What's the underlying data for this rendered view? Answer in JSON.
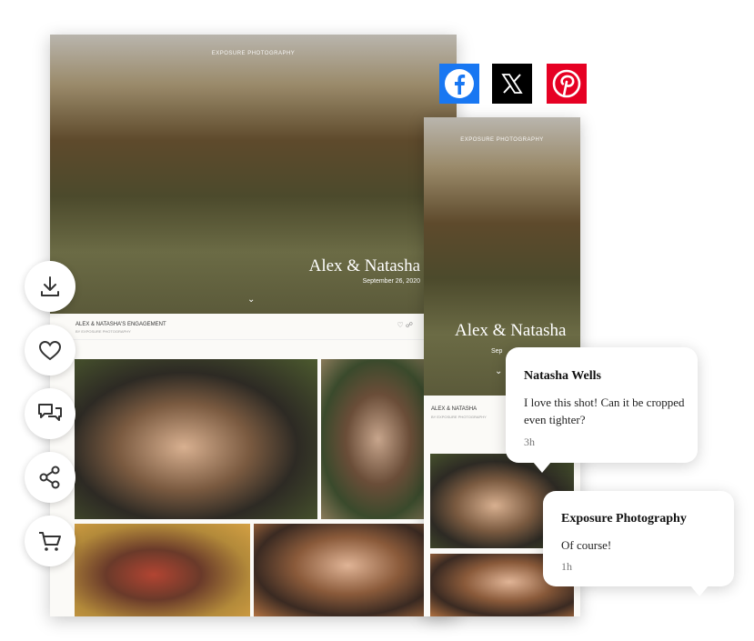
{
  "brand": "EXPOSURE PHOTOGRAPHY",
  "hero": {
    "title": "Alex & Natasha",
    "date": "September 26, 2020"
  },
  "gallery": {
    "title": "ALEX & NATASHA'S ENGAGEMENT",
    "byline": "BY EXPOSURE PHOTOGRAPHY"
  },
  "mobile": {
    "title": "Alex & Natasha",
    "date_partial": "Sep",
    "gallery_title": "ALEX & NATASHA",
    "byline": "BY EXPOSURE PHOTOGRAPHY"
  },
  "social": [
    {
      "name": "facebook",
      "icon": "facebook-icon",
      "color": "#1877f2"
    },
    {
      "name": "x",
      "icon": "x-icon",
      "color": "#000000"
    },
    {
      "name": "pinterest",
      "icon": "pinterest-icon",
      "color": "#e60023"
    }
  ],
  "actions": [
    "download-icon",
    "heart-icon",
    "comments-icon",
    "share-icon",
    "cart-icon"
  ],
  "comments": [
    {
      "name": "Natasha Wells",
      "text": "I love this shot! Can it be cropped even tighter?",
      "time": "3h"
    },
    {
      "name": "Exposure Photography",
      "text": "Of course!",
      "time": "1h"
    }
  ]
}
